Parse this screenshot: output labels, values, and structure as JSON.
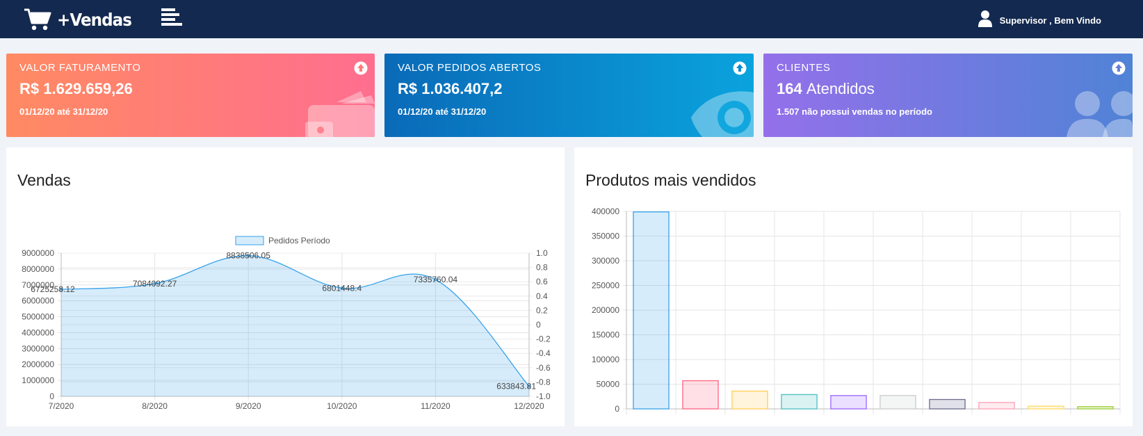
{
  "app": {
    "brand": "+Vendas",
    "user_greeting": "Supervisor , Bem Vindo"
  },
  "icons": {
    "cart": "shopping-cart-icon",
    "menu": "hamburger-menu-icon",
    "user": "user-icon",
    "up": "arrow-circle-up-icon"
  },
  "cards": [
    {
      "title": "VALOR FATURAMENTO",
      "value": "R$ 1.629.659,26",
      "subtitle": "01/12/20 até 31/12/20",
      "color_from": "#ff8a62",
      "color_to": "#ff6e8f",
      "decoration_icon": "wallet-icon"
    },
    {
      "title": "VALOR PEDIDOS ABERTOS",
      "value": "R$ 1.036.407,2",
      "subtitle": "01/12/20 até 31/12/20",
      "color_from": "#0a6ab8",
      "color_to": "#0aa3dd",
      "decoration_icon": "eye-icon"
    },
    {
      "title": "CLIENTES",
      "value_bold": "164",
      "value_light": "Atendidos",
      "subtitle": "1.507 não possui vendas no período",
      "color_from": "#9470ea",
      "color_to": "#5083d6",
      "decoration_icon": "users-icon"
    }
  ],
  "panels": {
    "sales_title": "Vendas",
    "products_title": "Produtos mais vendidos"
  },
  "chart_data": [
    {
      "type": "area",
      "title": "Vendas",
      "legend": [
        "Pedidos Período"
      ],
      "legend_position": "top",
      "x": [
        "7/2020",
        "8/2020",
        "9/2020",
        "10/2020",
        "11/2020",
        "12/2020"
      ],
      "series": [
        {
          "name": "Pedidos Período",
          "values": [
            6725258.12,
            7084092.27,
            8838506.05,
            6801448.4,
            7335760.04,
            633843.81
          ],
          "labels": [
            "6725258.12",
            "7084092.27",
            "8838506.05",
            "6801448.4",
            "7335760.04",
            "633843.81"
          ],
          "color": "#36a2eb"
        }
      ],
      "ylim": [
        0,
        9000000
      ],
      "yticks": [
        "9000000",
        "8000000",
        "7000000",
        "6000000",
        "5000000",
        "4000000",
        "3000000",
        "2000000",
        "1000000",
        "0"
      ],
      "y2ticks": [
        "1.0",
        "0.8",
        "0.6",
        "0.4",
        "0.2",
        "0",
        "-0.2",
        "-0.4",
        "-0.6",
        "-0.8",
        "-1.0"
      ],
      "grid": true
    },
    {
      "type": "bar",
      "title": "Produtos mais vendidos",
      "values": [
        399000,
        57000,
        36000,
        29000,
        27000,
        27000,
        19000,
        13000,
        5500,
        4500
      ],
      "colors": [
        "#36a2eb",
        "#ff6384",
        "#ffcd56",
        "#4bc0c0",
        "#9966ff",
        "#c9cbcf",
        "#6b6b8f",
        "#ff9fb5",
        "#ffd966",
        "#9acd32"
      ],
      "ylim": [
        0,
        400000
      ],
      "yticks": [
        "400000",
        "350000",
        "300000",
        "250000",
        "200000",
        "150000",
        "100000",
        "50000",
        "0"
      ],
      "grid": true
    }
  ]
}
